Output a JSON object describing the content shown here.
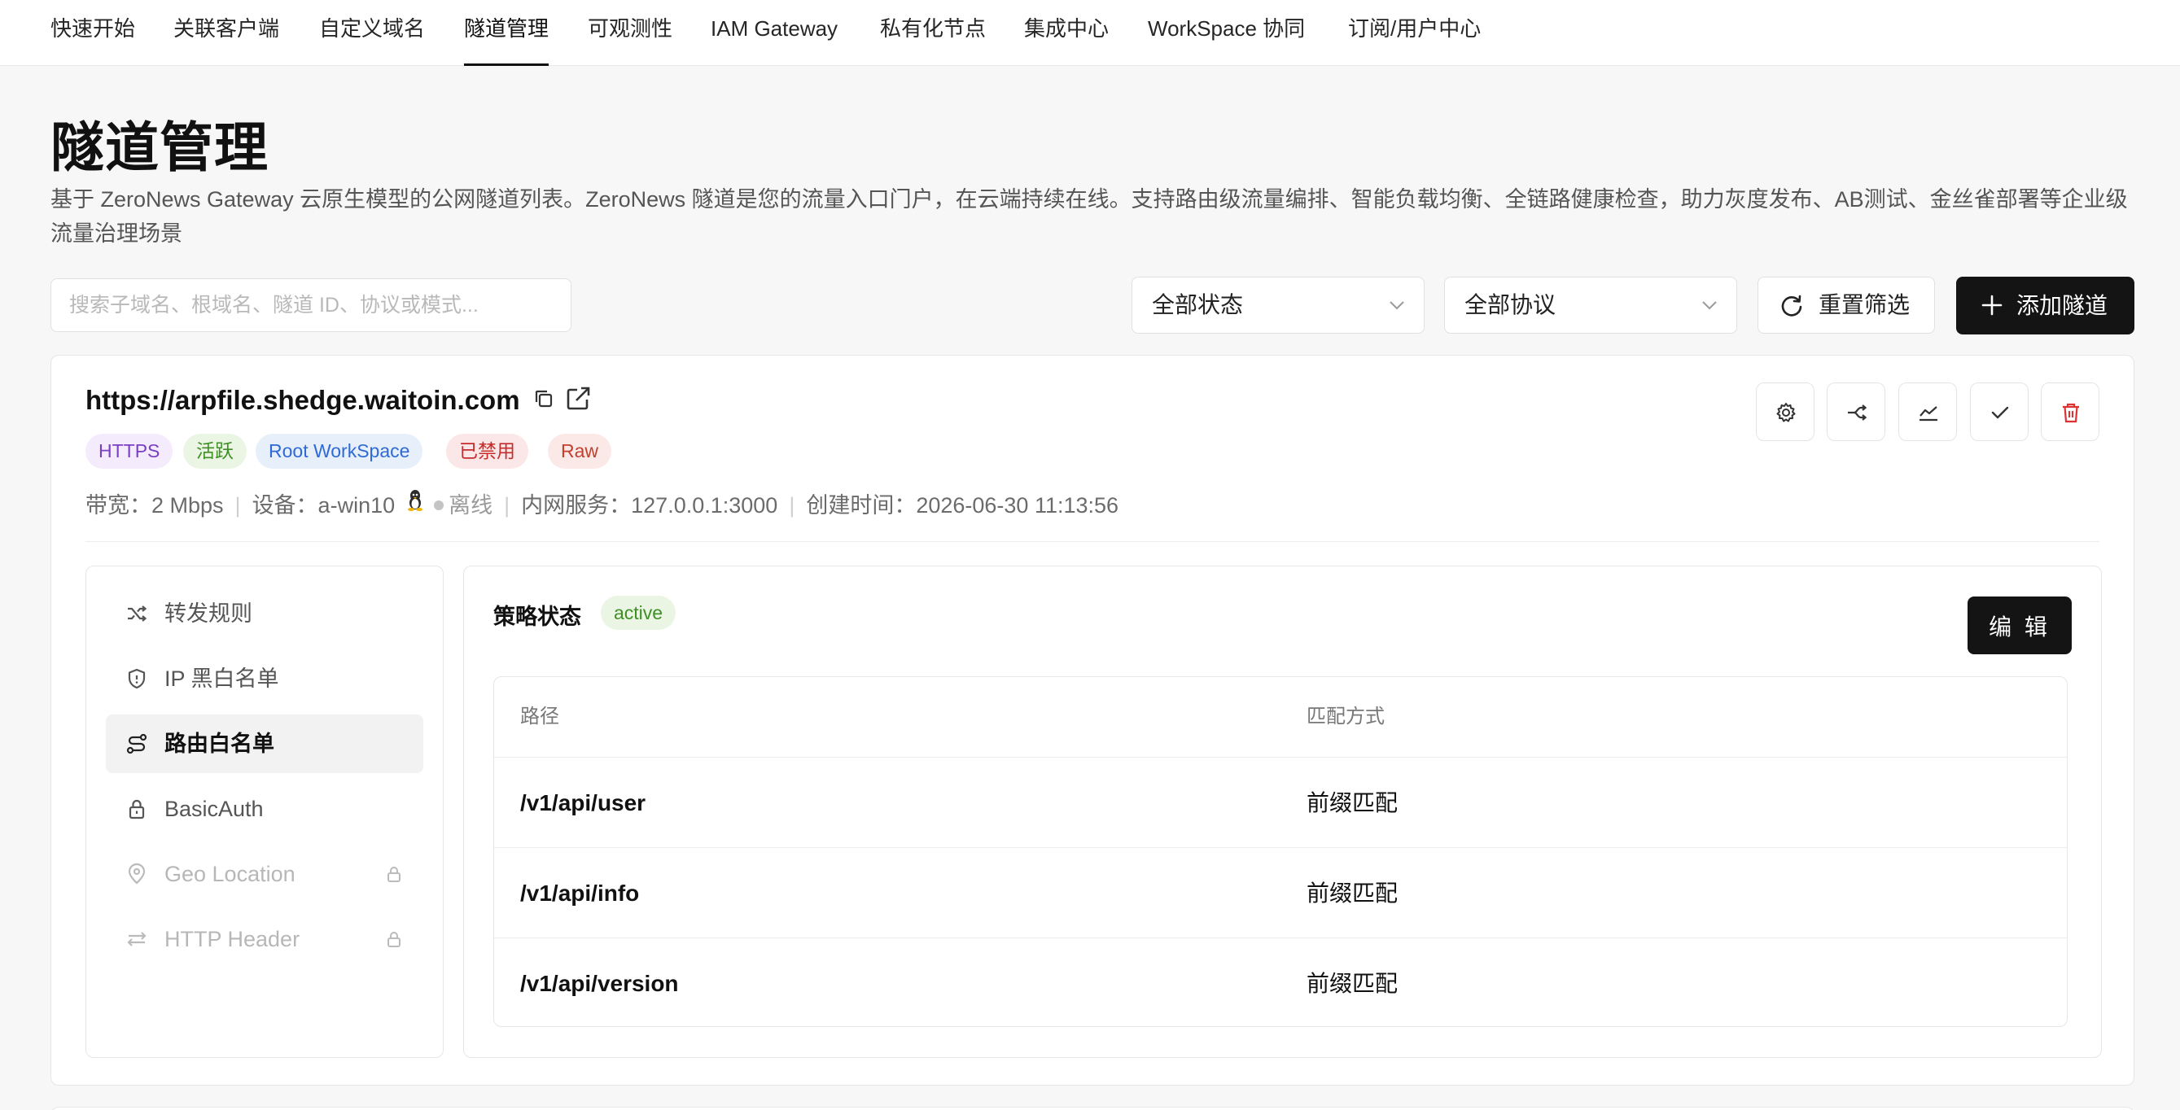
{
  "nav": {
    "tabs": [
      {
        "label": "快速开始"
      },
      {
        "label": "关联客户端"
      },
      {
        "label": "自定义域名"
      },
      {
        "label": "隧道管理"
      },
      {
        "label": "可观测性"
      },
      {
        "label": "IAM Gateway"
      },
      {
        "label": "私有化节点"
      },
      {
        "label": "集成中心"
      },
      {
        "label": "WorkSpace 协同"
      },
      {
        "label": "订阅/用户中心"
      }
    ],
    "active_tab": "隧道管理"
  },
  "header": {
    "title": "隧道管理",
    "description": "基于 ZeroNews Gateway 云原生模型的公网隧道列表。ZeroNews 隧道是您的流量入口门户，在云端持续在线。支持路由级流量编排、智能负载均衡、全链路健康检查，助力灰度发布、AB测试、金丝雀部署等企业级流量治理场景"
  },
  "filters": {
    "search_placeholder": "搜索子域名、根域名、隧道 ID、协议或模式...",
    "status_select": "全部状态",
    "protocol_select": "全部协议",
    "reset_label": "重置筛选",
    "add_label": "添加隧道"
  },
  "tunnel": {
    "url": "https://arpfile.shedge.waitoin.com",
    "tags": {
      "protocol": "HTTPS",
      "state": "活跃",
      "workspace": "Root WorkSpace",
      "disabled": "已禁用",
      "mode": "Raw"
    },
    "meta": {
      "bandwidth": "带宽：2 Mbps",
      "device": "设备：a-win10",
      "device_status": "离线",
      "service": "内网服务：127.0.0.1:3000",
      "created": "创建时间：2026-06-30 11:13:56"
    }
  },
  "side_menu": {
    "items": [
      {
        "label": "转发规则",
        "icon": "shuffle-icon"
      },
      {
        "label": "IP 黑白名单",
        "icon": "shield-icon"
      },
      {
        "label": "路由白名单",
        "icon": "route-icon"
      },
      {
        "label": "BasicAuth",
        "icon": "lock-icon"
      },
      {
        "label": "Geo Location",
        "icon": "location-pin-icon"
      },
      {
        "label": "HTTP Header",
        "icon": "swap-arrows-icon"
      }
    ],
    "active": "路由白名单"
  },
  "policy": {
    "title": "策略状态",
    "status": "active",
    "edit_label": "编 辑",
    "columns": [
      "路径",
      "匹配方式"
    ],
    "rows": [
      {
        "path": "/v1/api/user",
        "match": "前缀匹配"
      },
      {
        "path": "/v1/api/info",
        "match": "前缀匹配"
      },
      {
        "path": "/v1/api/version",
        "match": "前缀匹配"
      }
    ]
  },
  "colors": {
    "primary_button": "#141414",
    "active_green": "#3f8f25",
    "danger_red": "#e03131",
    "workspace_blue": "#2f6ad4",
    "https_purple": "#7b3fc4"
  }
}
